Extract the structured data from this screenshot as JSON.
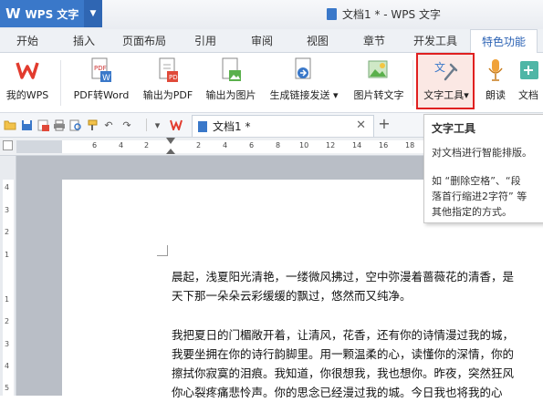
{
  "app": {
    "name": "WPS 文字",
    "logo": "W",
    "window_title": "文档1 * - WPS 文字"
  },
  "tabs": [
    "开始",
    "插入",
    "页面布局",
    "引用",
    "审阅",
    "视图",
    "章节",
    "开发工具",
    "特色功能"
  ],
  "ribbon": {
    "buttons": [
      "我的WPS",
      "PDF转Word",
      "输出为PDF",
      "输出为图片",
      "生成链接发送",
      "图片转文字",
      "文字工具",
      "朗读",
      "文档"
    ]
  },
  "doc_tab": {
    "name": "文档1 *"
  },
  "ruler_ticks": [
    "6",
    "4",
    "2",
    "2",
    "4",
    "6",
    "8",
    "10",
    "12",
    "14",
    "16",
    "18",
    "20",
    "22"
  ],
  "vruler_ticks": [
    "4",
    "3",
    "2",
    "1",
    "1",
    "2",
    "3",
    "4",
    "5",
    "6"
  ],
  "tooltip": {
    "title": "文字工具",
    "line1": "对文档进行智能排版。",
    "line2": "如 “删除空格”、“段",
    "line3": "落首行缩进2字符” 等",
    "line4": "其他指定的方式。"
  },
  "document": {
    "p1": [
      "晨起，浅夏阳光清艳，一缕微风拂过，空中弥漫着蔷薇花的清香，是",
      "天下那一朵朵云彩缓缓的飘过，悠然而又纯净。"
    ],
    "p2": [
      "我把夏日的门楣敞开着，让清风，花香，还有你的诗情漫过我的城，",
      "我要坐拥在你的诗行韵脚里。用一颗温柔的心，读懂你的深情，你的",
      "擦拭你寂寞的泪痕。我知道，你很想我，我也想你。昨夜，突然狂风",
      "你心裂疼痛悲怜声。你的思念已经漫过我的城。今日我也将我的心"
    ]
  },
  "colors": {
    "accent": "#3a78c9",
    "highlight_border": "#e02020",
    "active_tab_text": "#2b62b4"
  }
}
